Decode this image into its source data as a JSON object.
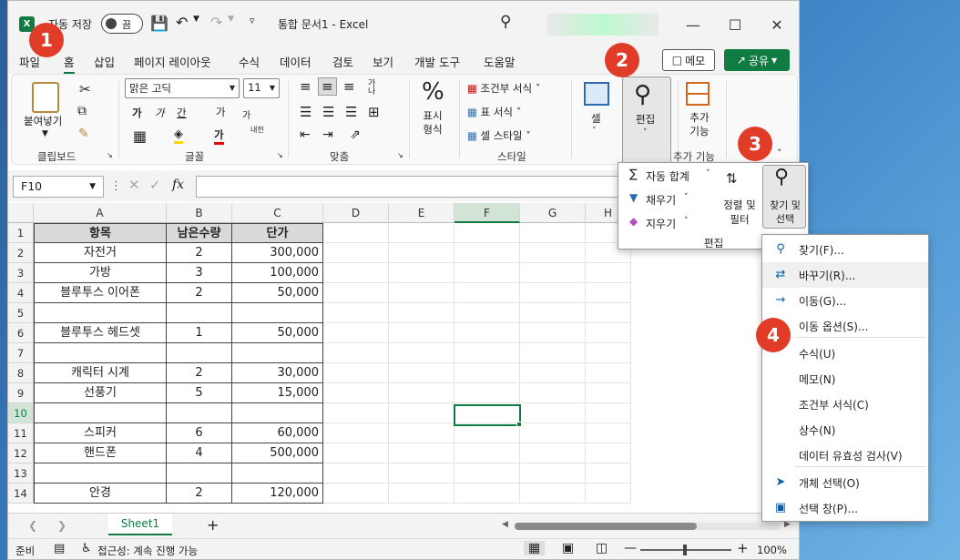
{
  "window": {
    "autosave_label": "자동 저장",
    "autosave_state": "끔",
    "title": "통합 문서1 - Excel",
    "logo": "X"
  },
  "tabs": [
    "파일",
    "홈",
    "삽입",
    "페이지 레이아웃",
    "수식",
    "데이터",
    "검토",
    "보기",
    "개발 도구",
    "도움말"
  ],
  "active_tab": "홈",
  "header_buttons": {
    "memo": "메모",
    "share": "공유"
  },
  "ribbon": {
    "paste": "붙여넣기",
    "font_name": "맑은 고딕",
    "font_size": "11",
    "bold": "가",
    "italic": "가",
    "underline": "간",
    "grow": "가",
    "shrink": "가",
    "fontcolor": "가",
    "phonetic": "내천",
    "wrap": "가나",
    "number_format": "표시 형식",
    "conditional": "조건부 서식",
    "table_format": "표 서식",
    "cell_style": "셀 스타일",
    "cells": "셀",
    "editing": "편집",
    "addins": "추가 기능",
    "groups": {
      "clipboard": "클립보드",
      "font": "글꼴",
      "alignment": "맞춤",
      "style": "스타일",
      "addins": "추가 기능"
    }
  },
  "formula_bar": {
    "name_box": "F10",
    "fx": "fx"
  },
  "grid": {
    "columns": [
      "A",
      "B",
      "C",
      "D",
      "E",
      "F",
      "G",
      "H"
    ],
    "rows": [
      "1",
      "2",
      "3",
      "4",
      "5",
      "6",
      "7",
      "8",
      "9",
      "10",
      "11",
      "12",
      "13",
      "14"
    ],
    "table": [
      [
        "항목",
        "남은수량",
        "단가"
      ],
      [
        "자전거",
        "2",
        "300,000"
      ],
      [
        "가방",
        "3",
        "100,000"
      ],
      [
        "블루투스 이어폰",
        "2",
        "50,000"
      ],
      [
        "",
        "",
        ""
      ],
      [
        "블루투스 헤드셋",
        "1",
        "50,000"
      ],
      [
        "",
        "",
        ""
      ],
      [
        "캐릭터 시계",
        "2",
        "30,000"
      ],
      [
        "선풍기",
        "5",
        "15,000"
      ],
      [
        "",
        "",
        ""
      ],
      [
        "스피커",
        "6",
        "60,000"
      ],
      [
        "핸드폰",
        "4",
        "500,000"
      ],
      [
        "",
        "",
        ""
      ],
      [
        "안경",
        "2",
        "120,000"
      ]
    ]
  },
  "sheet_tab": "Sheet1",
  "status": {
    "ready": "준비",
    "accessibility": "접근성: 계속 진행 가능",
    "zoom": "100%"
  },
  "edit_panel": {
    "autosum": "자동 합계",
    "fill": "채우기",
    "clear": "지우기",
    "sort_filter": "정렬 및 필터",
    "find_select": "찾기 및 선택",
    "group": "편집"
  },
  "find_menu": [
    {
      "label": "찾기(F)...",
      "icon": "search-icon"
    },
    {
      "label": "바꾸기(R)...",
      "icon": "replace-icon"
    },
    {
      "label": "이동(G)...",
      "icon": "arrow-right-icon"
    },
    {
      "label": "이동 옵션(S)...",
      "icon": ""
    },
    {
      "label": "수식(U)",
      "icon": ""
    },
    {
      "label": "메모(N)",
      "icon": ""
    },
    {
      "label": "조건부 서식(C)",
      "icon": ""
    },
    {
      "label": "상수(N)",
      "icon": ""
    },
    {
      "label": "데이터 유효성 검사(V)",
      "icon": ""
    },
    {
      "label": "개체 선택(O)",
      "icon": "cursor-icon"
    },
    {
      "label": "선택 창(P)...",
      "icon": "selection-pane-icon"
    }
  ],
  "badges": [
    "1",
    "2",
    "3",
    "4"
  ],
  "colors": {
    "excel_green": "#107c41",
    "badge_red": "#e03c28",
    "header_gray": "#d9d9d9"
  }
}
